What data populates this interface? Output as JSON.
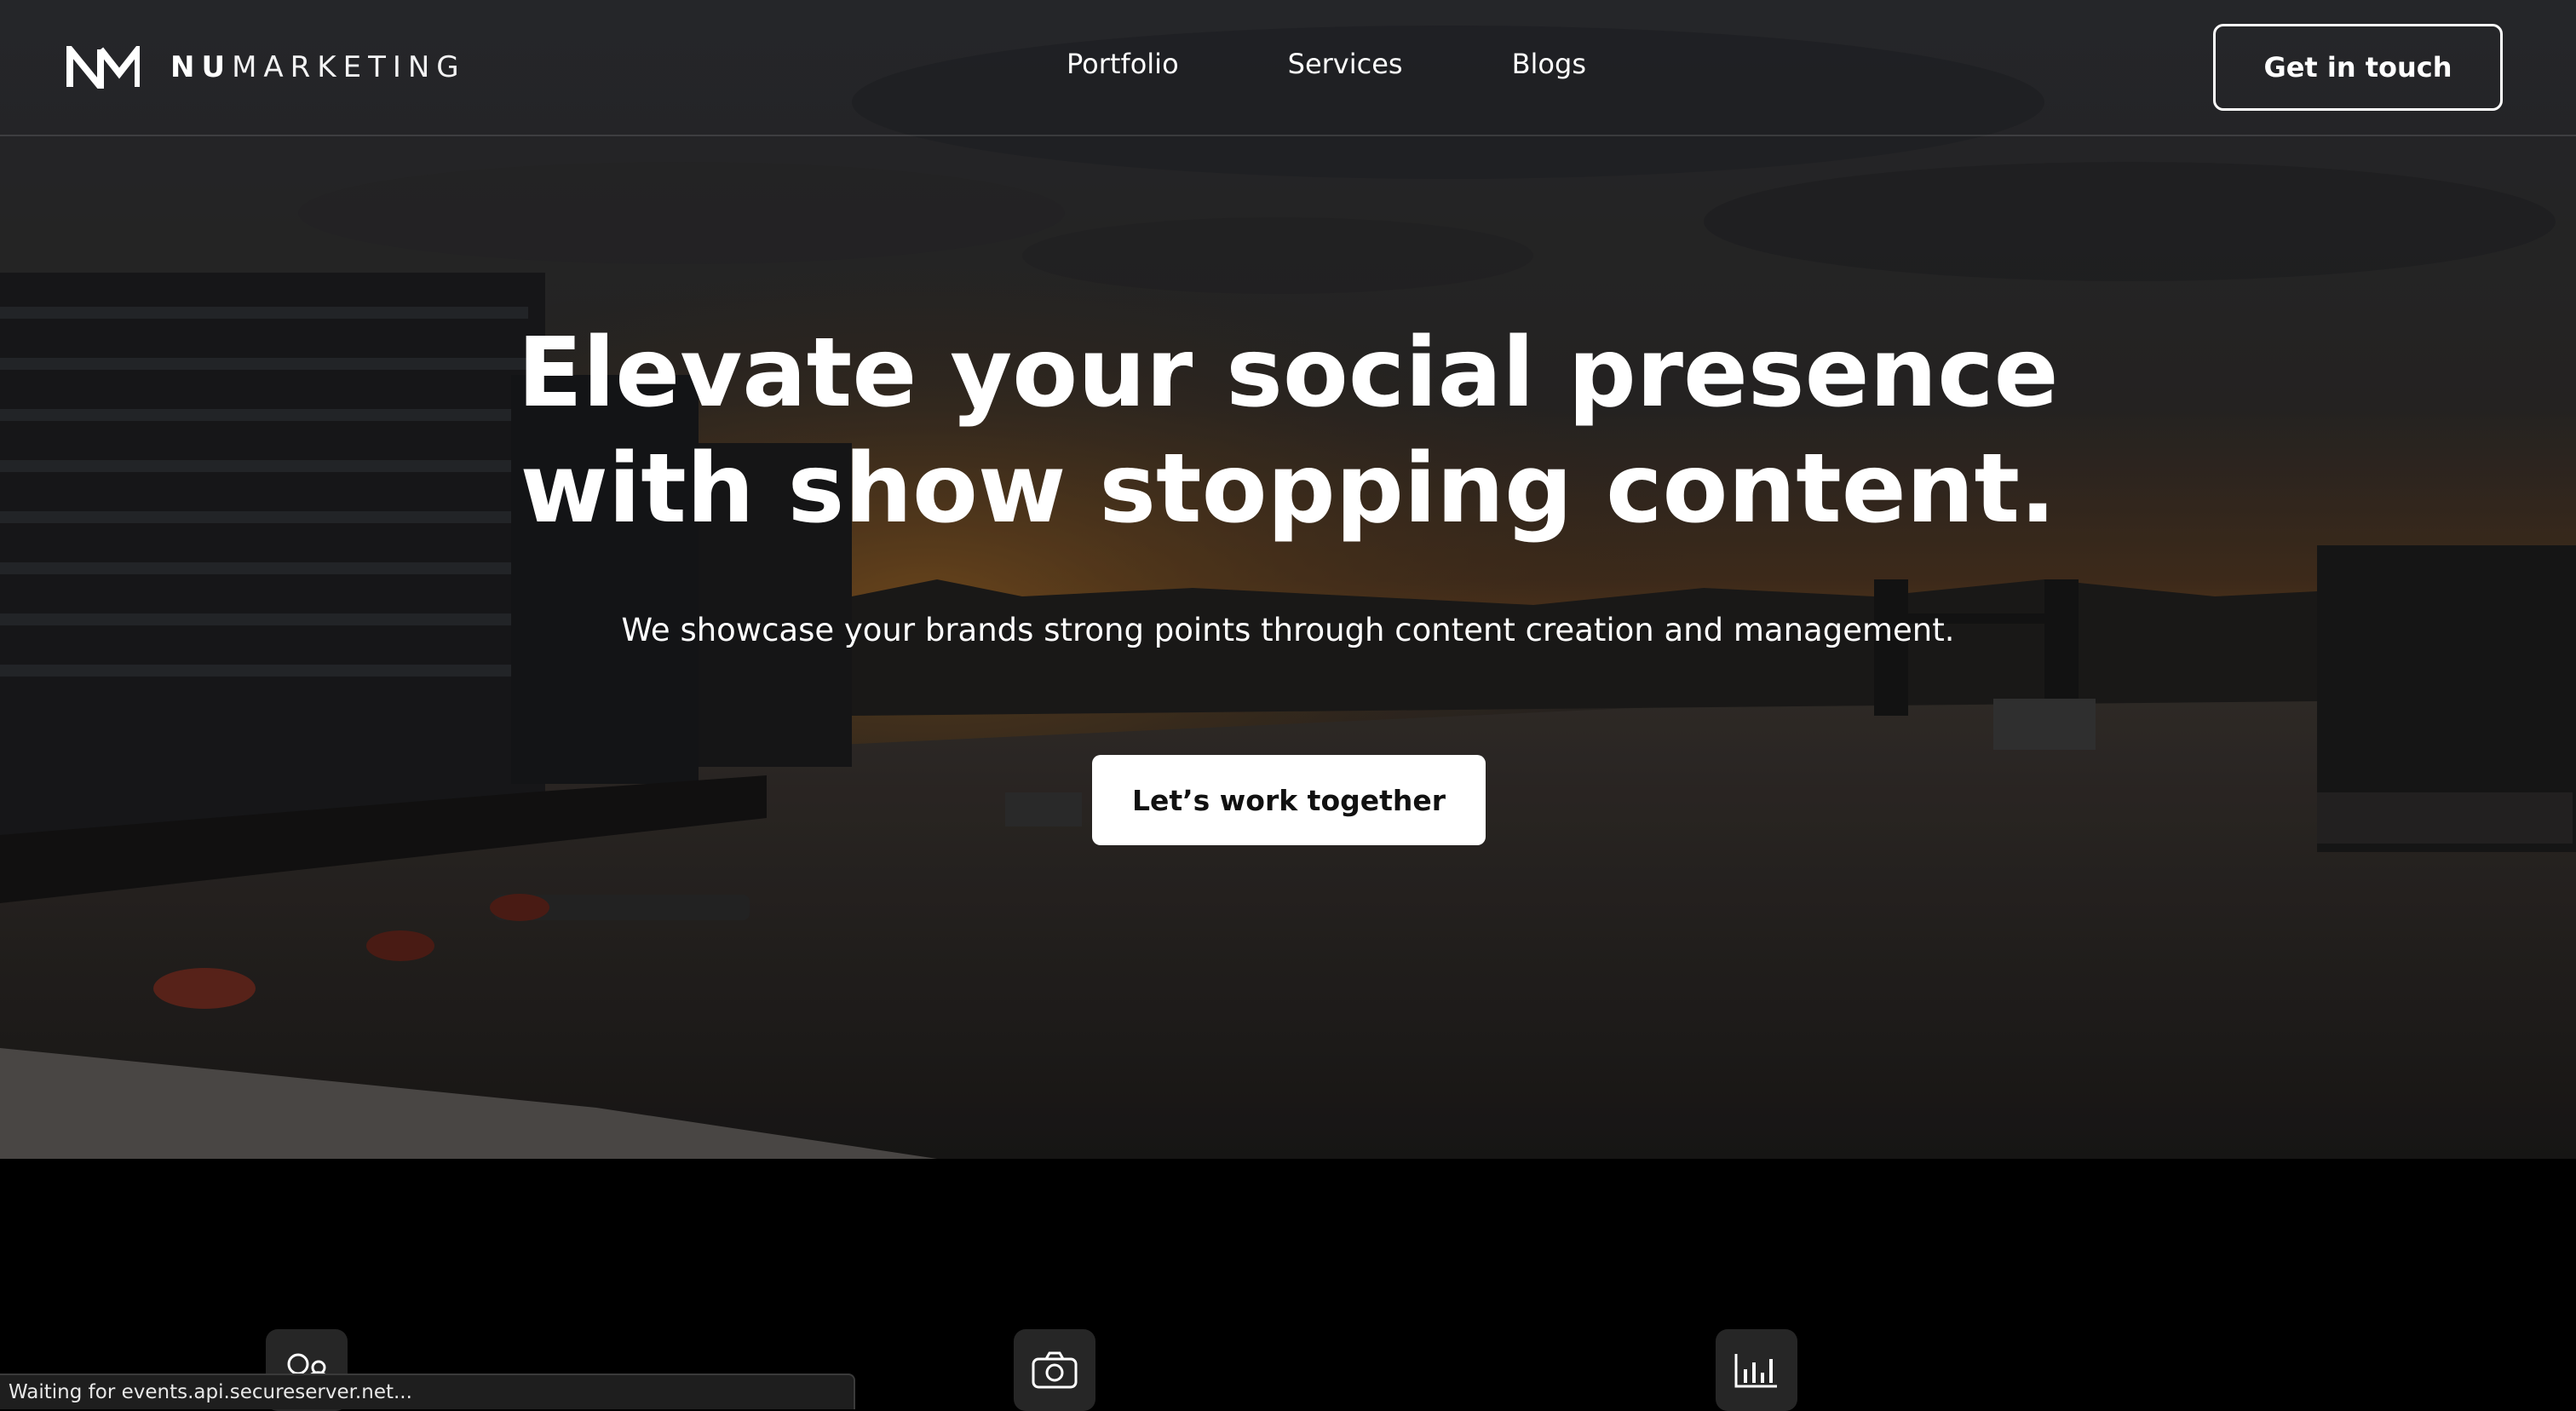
{
  "brand": {
    "name_bold": "NU",
    "name_light": "MARKETING",
    "logo_icon": "nm-monogram-icon"
  },
  "nav": {
    "items": [
      {
        "label": "Portfolio"
      },
      {
        "label": "Services"
      },
      {
        "label": "Blogs"
      }
    ],
    "cta_label": "Get in touch"
  },
  "hero": {
    "headline_line1": "Elevate your social presence",
    "headline_line2": "with show stopping content.",
    "subheadline": "We showcase your brands strong points through content creation and management.",
    "cta_label": "Let’s work together",
    "background": "dusk-city-river-skyline"
  },
  "features": {
    "icons": [
      "people-icon",
      "camera-icon",
      "bar-chart-icon"
    ]
  },
  "status_bar": {
    "text": "Waiting for events.api.secureserver.net..."
  },
  "colors": {
    "background": "#000000",
    "button_primary_bg": "#ffffff",
    "button_primary_text": "#111111",
    "text": "#ffffff"
  }
}
